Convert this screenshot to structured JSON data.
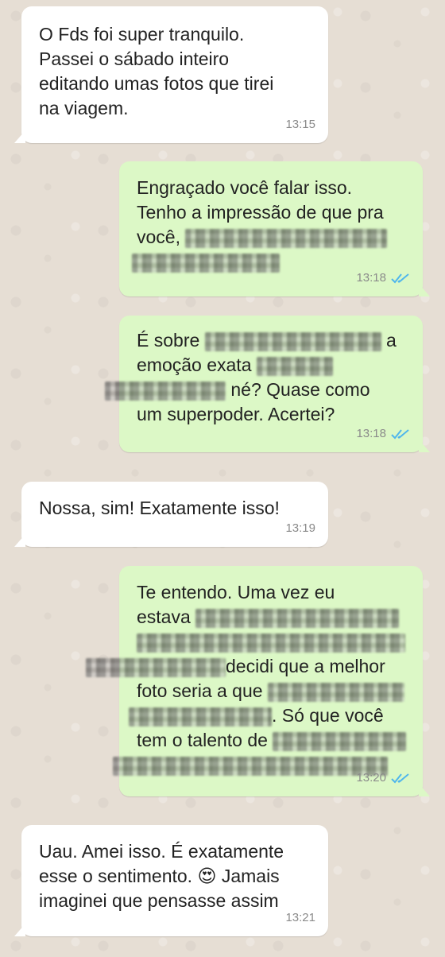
{
  "messages": [
    {
      "direction": "incoming",
      "lines": [
        {
          "text": "O Fds foi super tranquilo."
        },
        {
          "text": "Passei o sábado inteiro"
        },
        {
          "text": "editando umas fotos que tirei"
        },
        {
          "text": "na viagem."
        }
      ],
      "time": "13:15"
    },
    {
      "direction": "outgoing",
      "lines": [
        {
          "text": "Engraçado você falar isso."
        },
        {
          "text": "Tenho a impressão de que pra"
        },
        {
          "text": "você,"
        }
      ],
      "time": "13:18",
      "status": "read"
    },
    {
      "direction": "outgoing",
      "lines": [
        {
          "before": "É sobre ",
          "after": " a"
        },
        {
          "before": "emoção exata",
          "after": ""
        },
        {
          "before": "",
          "after": " né? Quase como"
        },
        {
          "text": "um superpoder. Acertei?"
        }
      ],
      "time": "13:18",
      "status": "read"
    },
    {
      "direction": "incoming",
      "lines": [
        {
          "text": "Nossa, sim! Exatamente isso!"
        }
      ],
      "time": "13:19"
    },
    {
      "direction": "outgoing",
      "lines": [
        {
          "text": "Te entendo. Uma vez eu"
        },
        {
          "before": "estava",
          "after": ""
        },
        {
          "before": "",
          "after": ""
        },
        {
          "before": "",
          "after": "decidi que a melhor"
        },
        {
          "before": "foto seria a que",
          "after": ""
        },
        {
          "before": "",
          "after": ". Só que você"
        },
        {
          "before": "tem o talento de",
          "after": ""
        }
      ],
      "time": "13:20",
      "status": "read"
    },
    {
      "direction": "incoming",
      "lines": [
        {
          "text": "Uau. Amei isso. É exatamente"
        },
        {
          "before": "esse o sentimento. ",
          "emoji": "😍",
          "after": " Jamais"
        },
        {
          "text": "imaginei que pensasse assim"
        }
      ],
      "time": "13:21"
    }
  ],
  "colors": {
    "background": "#e6ded4",
    "incoming_bubble": "#ffffff",
    "outgoing_bubble": "#dcf8c6",
    "read_ticks": "#4fb6ec",
    "time_text": "#8a8a8a"
  },
  "icons": {
    "read_status": "double-check-icon"
  }
}
